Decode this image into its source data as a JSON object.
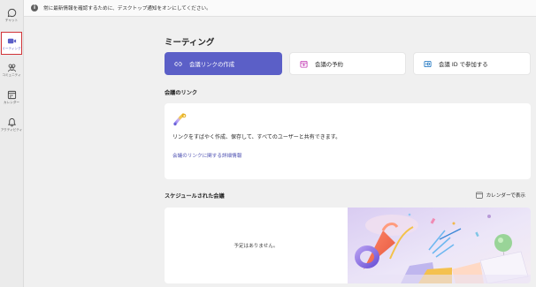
{
  "rail": {
    "items": [
      {
        "label": "チャット",
        "icon": "chat-icon"
      },
      {
        "label": "ミーティング",
        "icon": "video-camera-icon"
      },
      {
        "label": "コミュニティ",
        "icon": "community-icon"
      },
      {
        "label": "カレンダー",
        "icon": "calendar-icon"
      },
      {
        "label": "アクティビティ",
        "icon": "bell-icon"
      }
    ]
  },
  "banner": {
    "text": "常に最新情報を確認するために、デスクトップ通知をオンにしてください。",
    "icon": "info-icon"
  },
  "meet": {
    "title": "ミーティング",
    "create_link_label": "会議リンクの作成",
    "schedule_label": "会議の予約",
    "join_by_id_label": "会議 ID で参加する"
  },
  "links_section": {
    "heading": "会議のリンク",
    "description": "リンクをすばやく作成、保存して、すべてのユーザーと共有できます。",
    "info_link": "会議のリンクに関する詳細情報"
  },
  "scheduled_section": {
    "heading": "スケジュールされた会議",
    "calendar_button": "カレンダーで表示",
    "empty_text": "予定はありません。"
  },
  "colors": {
    "accent": "#5b5fc7",
    "selected_outline": "#d13438",
    "link": "#4f52b2"
  }
}
